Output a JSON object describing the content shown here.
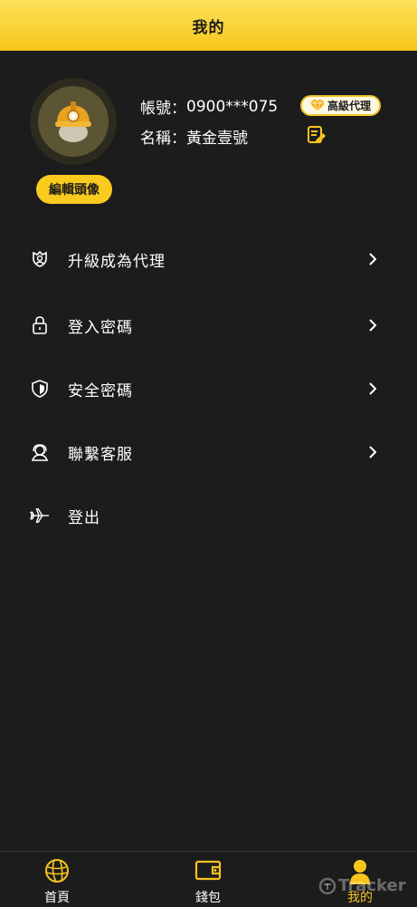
{
  "header": {
    "title": "我的"
  },
  "profile": {
    "account_label": "帳號：",
    "account_value": "0900***075",
    "name_label": "名稱：",
    "name_value": "黃金壹號",
    "badge": "高級代理",
    "edit_avatar": "編輯頭像"
  },
  "menu": [
    {
      "label": "升級成為代理",
      "icon": "agent-icon",
      "arrow": true
    },
    {
      "label": "登入密碼",
      "icon": "lock-icon",
      "arrow": true
    },
    {
      "label": "安全密碼",
      "icon": "shield-icon",
      "arrow": true
    },
    {
      "label": "聯繫客服",
      "icon": "headset-icon",
      "arrow": true
    },
    {
      "label": "登出",
      "icon": "plane-icon",
      "arrow": false
    }
  ],
  "tabs": [
    {
      "label": "首頁",
      "icon": "home-icon",
      "active": false
    },
    {
      "label": "錢包",
      "icon": "wallet-icon",
      "active": false
    },
    {
      "label": "我的",
      "icon": "user-icon",
      "active": true
    }
  ],
  "watermark": "Tracker",
  "colors": {
    "accent": "#f7c41c",
    "background": "#1c1c1c",
    "header": "#fbd93a"
  }
}
